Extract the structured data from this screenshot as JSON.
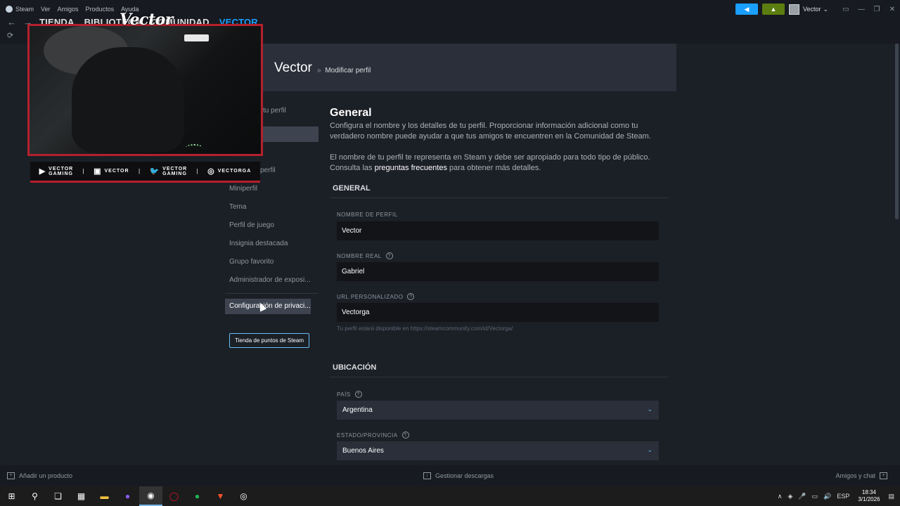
{
  "menu": [
    "Steam",
    "Ver",
    "Amigos",
    "Productos",
    "Ayuda"
  ],
  "nav": {
    "items": [
      "TIENDA",
      "BIBLIOTECA",
      "COMUNIDAD"
    ],
    "active": "VECTOR"
  },
  "user": {
    "name": "Vector",
    "chevron": "⌄"
  },
  "header": {
    "name": "Vector",
    "crumb_sep": "»",
    "crumb": "Modificar perfil"
  },
  "overlay": {
    "logo": "Vector",
    "socials": [
      {
        "glyph": "▶",
        "text": "VECTOR\nGAMING",
        "icon": "youtube-icon"
      },
      {
        "glyph": "▣",
        "text": "VECTOR",
        "icon": "twitch-icon"
      },
      {
        "glyph": "🐦",
        "text": "VECTOR\nGAMING",
        "icon": "twitter-icon"
      },
      {
        "glyph": "◎",
        "text": "VECTORGA",
        "icon": "instagram-icon"
      }
    ]
  },
  "leftnav": {
    "top_partial": "tu perfil",
    "partial_item": "perfil",
    "items": [
      "Miniperfil",
      "Tema",
      "Perfil de juego",
      "Insignia destacada",
      "Grupo favorito",
      "Administrador de exposi..."
    ],
    "privacy": "Configuración de privaci...",
    "points_button": "Tienda de puntos de Steam"
  },
  "general": {
    "title": "General",
    "para1": "Configura el nombre y los detalles de tu perfil. Proporcionar información adicional como tu verdadero nombre puede ayudar a que tus amigos te encuentren en la Comunidad de Steam.",
    "para2_a": "El nombre de tu perfil te representa en Steam y debe ser apropiado para todo tipo de público. Consulta las ",
    "para2_link": "preguntas frecuentes",
    "para2_b": " para obtener más detalles.",
    "group": "GENERAL",
    "profile_name_label": "NOMBRE DE PERFIL",
    "profile_name": "Vector",
    "real_name_label": "NOMBRE REAL",
    "real_name": "Gabriel",
    "url_label": "URL PERSONALIZADO",
    "url": "Vectorga",
    "url_hint": "Tu perfil estará disponible en https://steamcommunity.com/id/Vectorga/"
  },
  "location": {
    "group": "UBICACIÓN",
    "country_label": "PAÍS",
    "country": "Argentina",
    "state_label": "ESTADO/PROVINCIA",
    "state": "Buenos Aires"
  },
  "statusbar": {
    "add_product": "Añadir un producto",
    "downloads": "Gestionar descargas",
    "friends": "Amigos y chat"
  },
  "taskbar": {
    "lang": "ESP",
    "time": "18:34",
    "date": "3/1/2026"
  },
  "colors": {
    "accent": "#1a9fff",
    "brand_red": "#b5202c",
    "link": "#67c1f5"
  }
}
